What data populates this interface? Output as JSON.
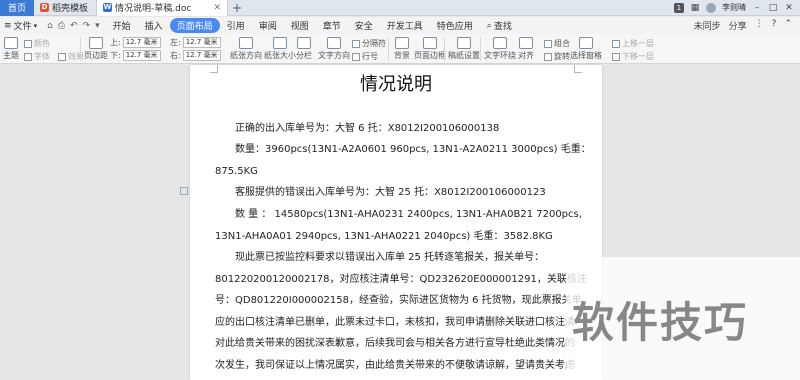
{
  "titlebar": {
    "home_tab": "首页",
    "template_tab": "稻壳模板",
    "doc_tab": "情况说明-草稿.doc",
    "add_tab": "+",
    "page_count": "1",
    "user_name": "李则晴",
    "minimize": "–",
    "restore": "□",
    "close": "✕"
  },
  "menubar": {
    "file_label": "文件",
    "quick_icons": [
      "⌂",
      "⎙",
      "↶",
      "↷",
      "▾"
    ],
    "items": [
      "开始",
      "插入",
      "页面布局",
      "引用",
      "审阅",
      "视图",
      "章节",
      "安全",
      "开发工具",
      "特色应用"
    ],
    "active_item": "页面布局",
    "search_label": "查找",
    "sync_label": "未同步",
    "share_label": "分享",
    "more": "⋮",
    "help": "?",
    "collapse": "⌃"
  },
  "ribbon": {
    "theme": "主题",
    "color": "颜色",
    "font": "字体",
    "effect": "效果",
    "margins": "页边距",
    "top_label": "上:",
    "top_value": "12.7 毫米",
    "bottom_label": "下:",
    "bottom_value": "12.7 毫米",
    "left_label": "左:",
    "left_value": "12.7 毫米",
    "right_label": "右:",
    "right_value": "12.7 毫米",
    "orientation": "纸张方向",
    "size": "纸张大小",
    "columns": "分栏",
    "text_direction": "文字方向",
    "separator": "分隔符",
    "line_numbers": "行号",
    "background": "背景",
    "borders": "页面边框",
    "draft": "稿纸设置",
    "wrap": "文字环绕",
    "align": "对齐",
    "rotate": "旋转",
    "group": "组合",
    "up_one": "上移一层",
    "down_one": "下移一层",
    "selection_pane": "选择窗格"
  },
  "document": {
    "title": "情况说明",
    "paragraphs": [
      "正确的出入库单号为：大智 6 托：X8012I200106000138",
      "数量：3960pcs(13N1-A2A0601 960pcs, 13N1-A2A0211 3000pcs)      毛重：",
      "875.5KG",
      "客服提供的错误出入库单号为：大智 25 托：X8012I200106000123",
      "数  量 ： 14580pcs(13N1-AHA0231   2400pcs,   13N1-AHA0B21   7200pcs,",
      "13N1-AHA0A01 2940pcs, 13N1-AHA0221 2040pcs)       毛重：3582.8KG",
      "现此票已按监控料要求以错误出入库单 25 托转逐笔报关，报关单号：",
      "801220200120002178，对应核注清单号：QD232620E000001291，关联核注",
      "号：QD801220I000002158，经查验，实际进区货物为 6 托货物，现此票报关单",
      "应的出口核注清单已删单，此票未过卡口，未核扣，我司申请删除关联进口核注清",
      "对此给贵关带来的困扰深表歉意，后续我司会与相关各方进行宣导杜绝此类情况的",
      "次发生，我司保证以上情况属实，由此给贵关带来的不便敬请谅解，望请贵关考虑"
    ]
  },
  "watermark": {
    "text": "软件技巧"
  }
}
